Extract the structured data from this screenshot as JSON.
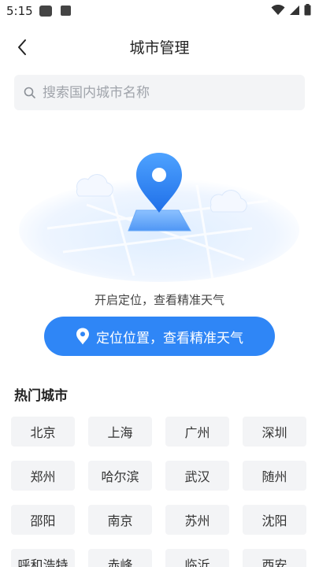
{
  "status_bar": {
    "time": "5:15"
  },
  "header": {
    "title": "城市管理"
  },
  "search": {
    "placeholder": "搜索国内城市名称"
  },
  "location": {
    "hint": "开启定位，查看精准天气",
    "button_label": "定位位置，查看精准天气"
  },
  "hot_cities": {
    "title": "热门城市",
    "cities": [
      "北京",
      "上海",
      "广州",
      "深圳",
      "郑州",
      "哈尔滨",
      "武汉",
      "随州",
      "邵阳",
      "南京",
      "苏州",
      "沈阳",
      "呼和浩特",
      "赤峰",
      "临沂",
      "西安"
    ]
  },
  "colors": {
    "accent": "#2f86f6",
    "chip_bg": "#f3f4f6",
    "search_bg": "#f3f4f6"
  }
}
